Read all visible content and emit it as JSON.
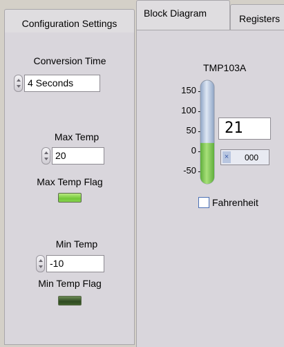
{
  "tabs": {
    "configuration_settings": "Configuration Settings",
    "block_diagram": "Block Diagram",
    "registers": "Registers"
  },
  "left": {
    "conversion_time": {
      "label": "Conversion Time",
      "value": "4 Seconds"
    },
    "max_temp": {
      "label": "Max Temp",
      "value": "20"
    },
    "max_temp_flag": {
      "label": "Max Temp Flag",
      "state": "on"
    },
    "min_temp": {
      "label": "Min Temp",
      "value": "-10"
    },
    "min_temp_flag": {
      "label": "Min Temp Flag",
      "state": "off"
    }
  },
  "block_diagram": {
    "device_title": "TMP103A",
    "scale_ticks": [
      "150",
      "100",
      "50",
      "0",
      "-50"
    ],
    "thermometer_value": 21,
    "scale_range": [
      -50,
      150
    ],
    "temperature_display": "21",
    "register_display": "000",
    "register_indicator": "×",
    "fahrenheit_label": "Fahrenheit",
    "fahrenheit_checked": false
  },
  "colors": {
    "panel": "#d9d6dc",
    "thermo_fill": "#84c95c",
    "thermo_tube": "#b9cbe6",
    "led_on": "#8fd855",
    "led_off": "#3a5a2b"
  },
  "icons": [
    "spinner-icon",
    "thermometer-icon",
    "checkbox-icon"
  ]
}
